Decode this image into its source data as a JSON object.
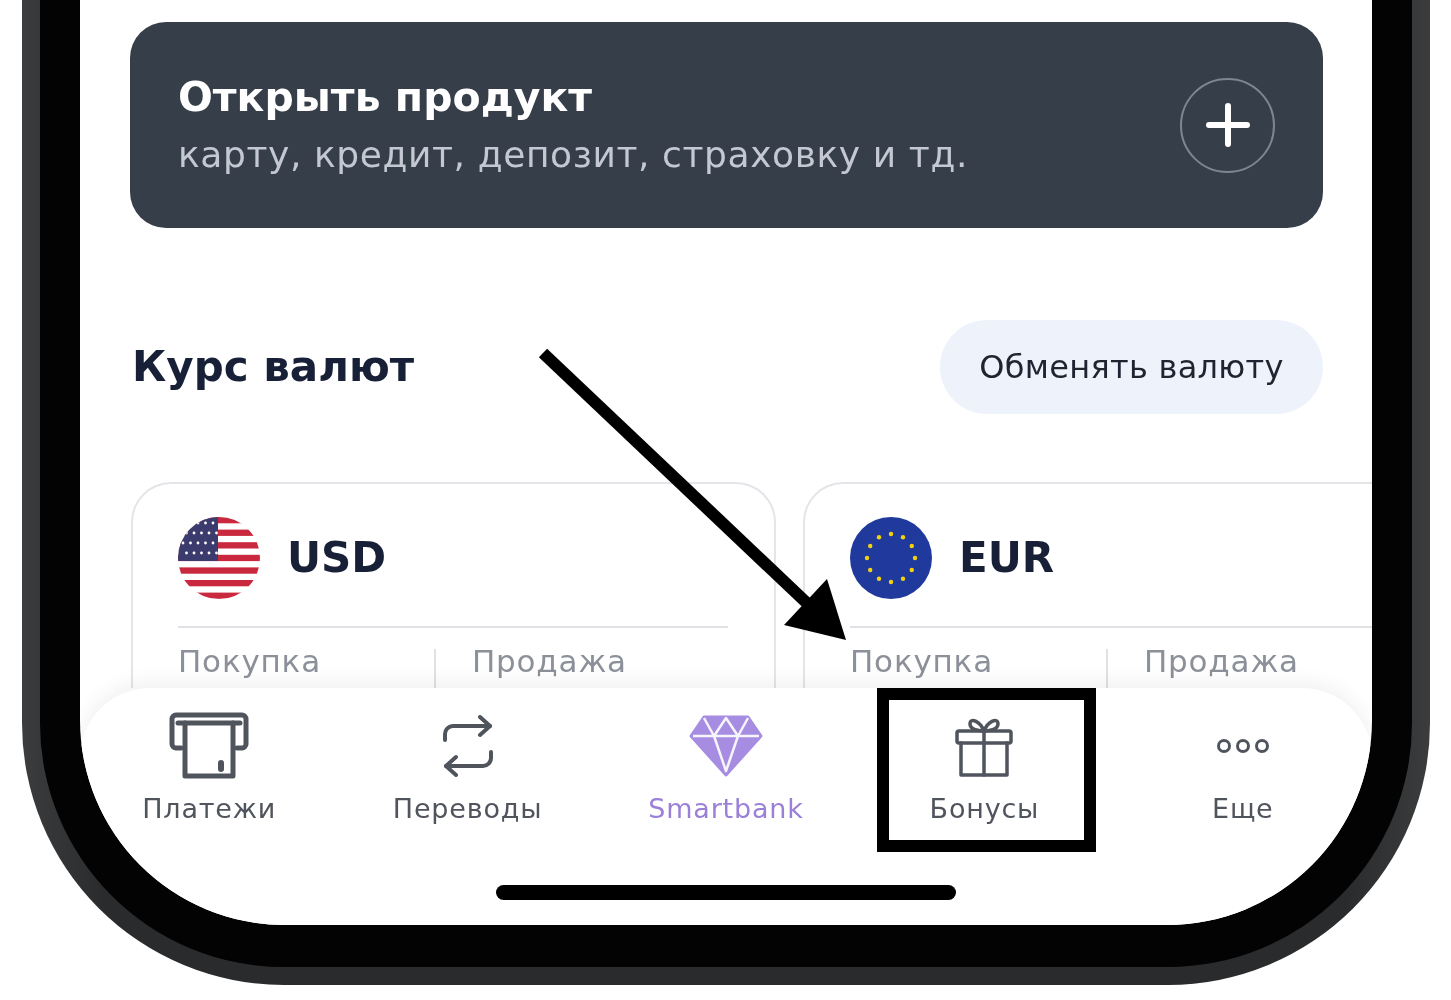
{
  "product_card": {
    "title": "Открыть продукт",
    "subtitle": "карту, кредит, депозит, страховку и тд."
  },
  "exchange_rates": {
    "title": "Курс валют",
    "exchange_button": "Обменять валюту",
    "currencies": [
      {
        "code": "USD",
        "buy_label": "Покупка",
        "sell_label": "Продажа"
      },
      {
        "code": "EUR",
        "buy_label": "Покупка",
        "sell_label": "Продажа"
      }
    ]
  },
  "tab_bar": {
    "tabs": [
      {
        "label": "Платежи",
        "selected": false,
        "highlighted": false
      },
      {
        "label": "Переводы",
        "selected": false,
        "highlighted": false
      },
      {
        "label": "Smartbank",
        "selected": true,
        "highlighted": false
      },
      {
        "label": "Бонусы",
        "selected": false,
        "highlighted": true
      },
      {
        "label": "Еще",
        "selected": false,
        "highlighted": false
      }
    ]
  }
}
